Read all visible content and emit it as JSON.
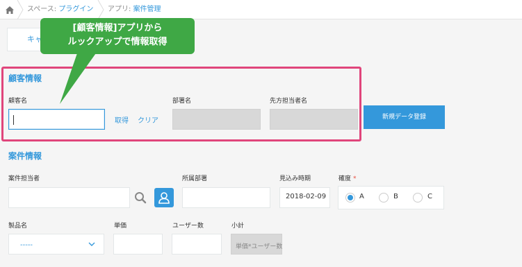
{
  "breadcrumb": {
    "space_prefix": "スペース: ",
    "space_link": "プラグイン",
    "app_prefix": "アプリ: ",
    "app_link": "案件管理"
  },
  "toolbar": {
    "cancel_label": "キャンセル"
  },
  "callout": {
    "line1": "[顧客情報]アプリから",
    "line2": "ルックアップで情報取得"
  },
  "customer_section": {
    "title": "顧客情報",
    "customer_name_label": "顧客名",
    "customer_name_value": "",
    "fetch_label": "取得",
    "clear_label": "クリア",
    "department_label": "部署名",
    "contact_label": "先方担当者名",
    "new_record_button": "新規データ登録"
  },
  "deal_section": {
    "title": "案件情報",
    "owner_label": "案件担当者",
    "owner_value": "",
    "dept_label": "所属部署",
    "dept_value": "",
    "forecast_label": "見込み時期",
    "forecast_value": "2018-02-09",
    "certainty_label": "確度",
    "certainty_required": "*",
    "certainty_options": [
      "A",
      "B",
      "C"
    ],
    "certainty_selected": "A",
    "product_label": "製品名",
    "product_value": "-----",
    "price_label": "単価",
    "users_label": "ユーザー数",
    "subtotal_label": "小計",
    "subtotal_value": "単価*ユーザー数"
  },
  "colors": {
    "accent": "#3498db",
    "callout": "#3fa845",
    "highlight": "#e0457b",
    "required": "#e74c3c"
  },
  "icons": [
    "home-icon",
    "search-icon",
    "user-icon",
    "chevron-down-icon"
  ]
}
